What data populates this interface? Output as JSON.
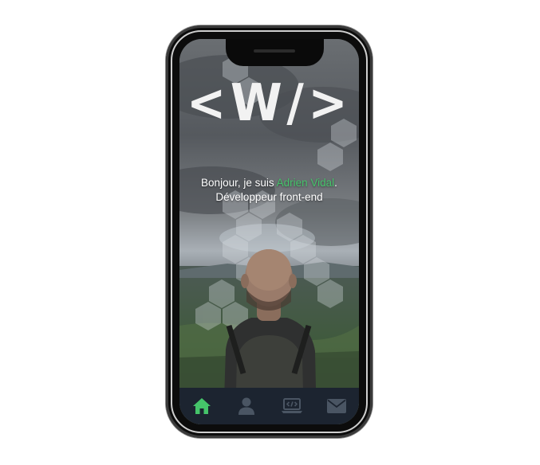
{
  "logo": {
    "text": "<W/>"
  },
  "intro": {
    "greeting": "Bonjour, je suis ",
    "name": "Adrien Vidal",
    "period": ".",
    "role": "Développeur front-end"
  },
  "nav": {
    "items": [
      {
        "icon": "home-icon",
        "active": true
      },
      {
        "icon": "user-icon",
        "active": false
      },
      {
        "icon": "laptop-code-icon",
        "active": false
      },
      {
        "icon": "envelope-icon",
        "active": false
      }
    ]
  },
  "colors": {
    "accent": "#45c46a",
    "nav_background": "#1c2430",
    "nav_inactive": "#4a5563",
    "phone_frame": "#0c0c0c"
  }
}
